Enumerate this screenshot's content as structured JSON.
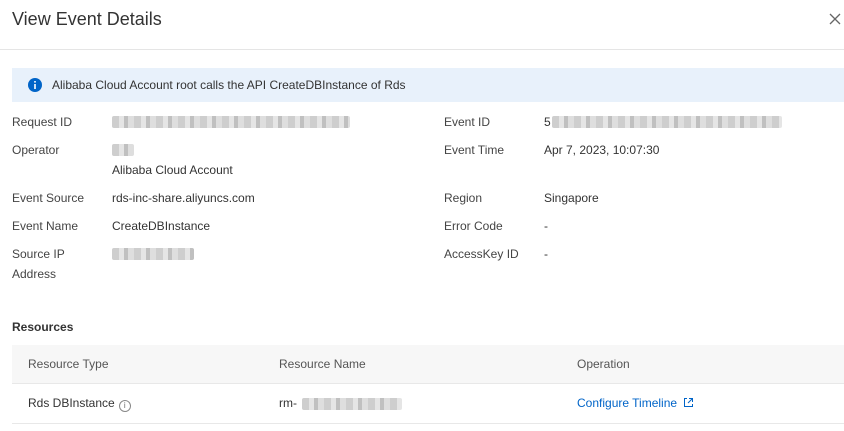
{
  "dialog": {
    "title": "View Event Details",
    "close_icon": "close-icon"
  },
  "alert": {
    "icon": "info-icon",
    "text": "Alibaba Cloud Account root calls the API CreateDBInstance of Rds",
    "background": "#e8f1fb",
    "icon_color": "#0064c8"
  },
  "details": {
    "left": [
      {
        "label": "Request ID",
        "value": ""
      },
      {
        "label": "Operator",
        "value": "Alibaba Cloud Account"
      },
      {
        "label": "Event Source",
        "value": "rds-inc-share.aliyuncs.com"
      },
      {
        "label": "Event Name",
        "value": "CreateDBInstance"
      },
      {
        "label": "Source IP Address",
        "value": ""
      }
    ],
    "right": [
      {
        "label": "Event ID",
        "value": "5"
      },
      {
        "label": "Event Time",
        "value": "Apr 7, 2023, 10:07:30"
      },
      {
        "label": "Region",
        "value": "Singapore"
      },
      {
        "label": "Error Code",
        "value": "-"
      },
      {
        "label": "AccessKey ID",
        "value": "-"
      }
    ]
  },
  "resources": {
    "title": "Resources",
    "columns": [
      "Resource Type",
      "Resource Name",
      "Operation"
    ],
    "rows": [
      {
        "type": "Rds DBInstance",
        "name": "rm-",
        "operation": "Configure Timeline"
      }
    ]
  },
  "colors": {
    "link": "#0064c8"
  }
}
